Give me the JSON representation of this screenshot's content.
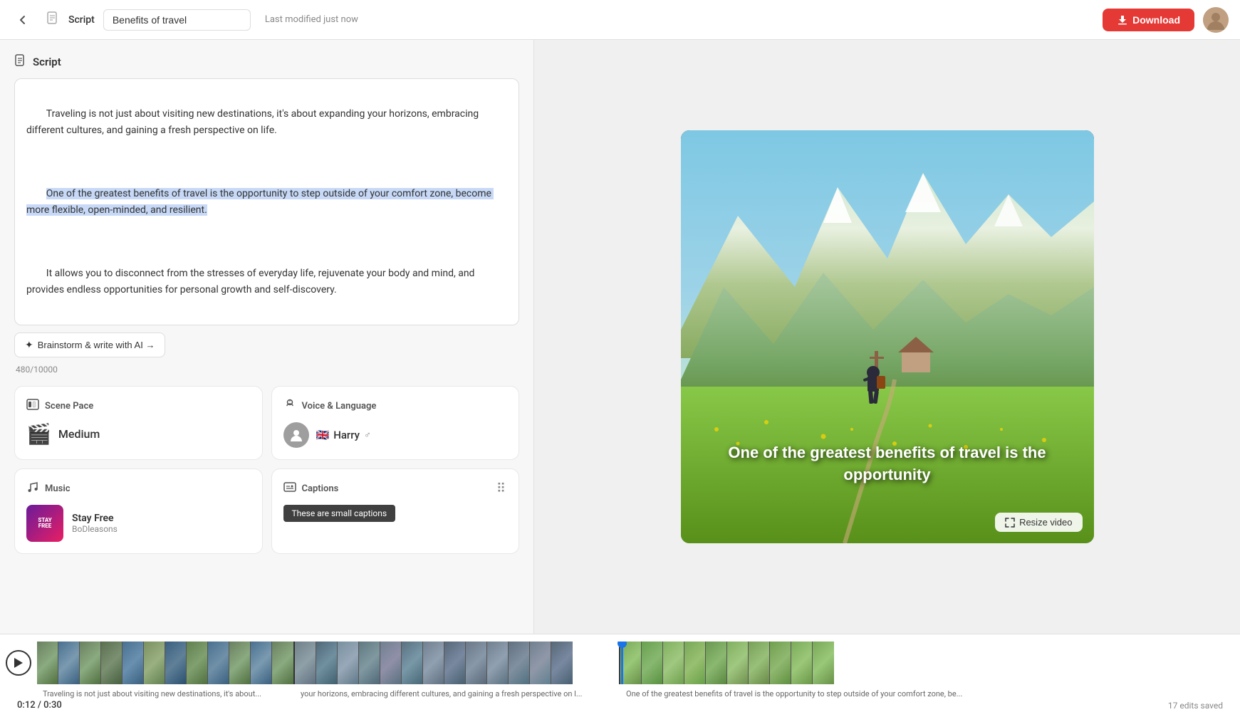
{
  "header": {
    "back_label": "←",
    "doc_icon": "📄",
    "script_label": "Script",
    "title_value": "Benefits of travel",
    "modified_text": "Last modified just now",
    "download_label": "Download"
  },
  "script": {
    "section_icon": "📄",
    "section_title": "Script",
    "paragraph1": "Traveling is not just about visiting new destinations, it's about expanding your horizons, embracing different cultures, and gaining a fresh perspective on life.",
    "paragraph2_highlighted": "One of the greatest benefits of travel is the opportunity to step outside of your comfort zone, become more flexible, open-minded, and resilient.",
    "paragraph3": "It allows you to disconnect from the stresses of everyday life, rejuvenate your body and mind, and provides endless opportunities for personal growth and self-discovery.",
    "brainstorm_label": "Brainstorm & write with AI →",
    "char_count": "480/10000"
  },
  "scene_pace": {
    "icon": "🖼",
    "title": "Scene Pace",
    "value": "Medium",
    "pace_icon": "⏱"
  },
  "voice_language": {
    "icon": "🎤",
    "title": "Voice & Language",
    "flag": "🇬🇧",
    "name": "Harry",
    "gender_icon": "♂"
  },
  "music": {
    "icon": "🎵",
    "title": "Music",
    "track_name": "Stay Free",
    "artist": "BoDleasons"
  },
  "captions": {
    "icon": "💬",
    "title": "Captions",
    "preview_text": "These are small captions",
    "dots_icon": "⋮⋮"
  },
  "video": {
    "overlay_line1": "One of the greatest benefits of travel is the",
    "overlay_line2": "opportunity",
    "resize_label": "Resize video"
  },
  "timeline": {
    "time_current": "0:12",
    "time_total": "0:30",
    "time_display": "0:12 / 0:30",
    "edits_saved": "17 edits saved",
    "captions": [
      "Traveling is not just about visiting new destinations, it's about...",
      "your horizons, embracing different cultures, and gaining a fresh perspective on l...",
      "One of the greatest benefits of travel is the opportunity to step outside of your comfort zone, be..."
    ]
  }
}
